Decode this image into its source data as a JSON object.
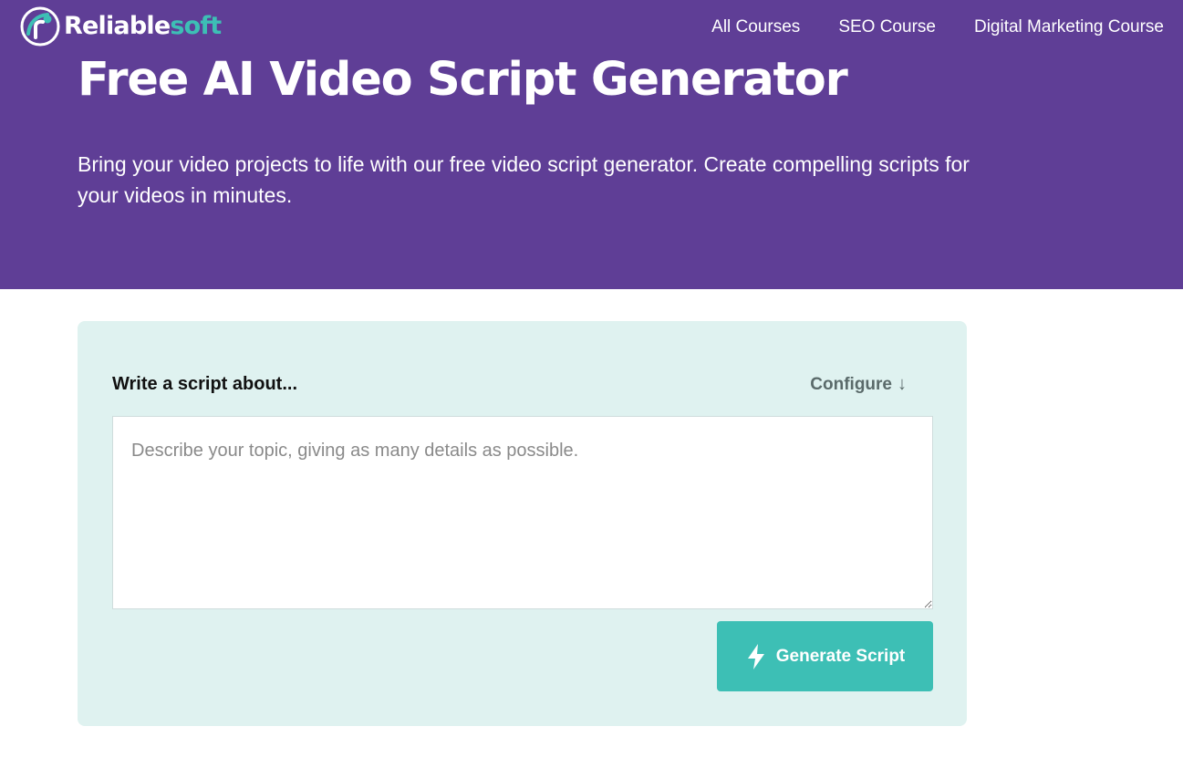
{
  "brand": {
    "name_part1": "Reliable",
    "name_part2": "soft",
    "logo_icon": "reliablesoft-logo-icon",
    "colors": {
      "purple": "#5f3e96",
      "teal": "#3dbfb5"
    }
  },
  "nav": {
    "items": [
      {
        "label": "All Courses"
      },
      {
        "label": "SEO Course"
      },
      {
        "label": "Digital Marketing Course"
      }
    ]
  },
  "hero": {
    "title": "Free AI Video Script Generator",
    "subtitle": "Bring your video projects to life with our free video script generator. Create compelling scripts for your videos in minutes."
  },
  "form": {
    "label": "Write a script about...",
    "configure_label": "Configure",
    "configure_icon": "arrow-down-icon",
    "topic": {
      "value": "",
      "placeholder": "Describe your topic, giving as many details as possible."
    },
    "generate_label": "Generate Script",
    "generate_icon": "lightning-bolt-icon"
  }
}
